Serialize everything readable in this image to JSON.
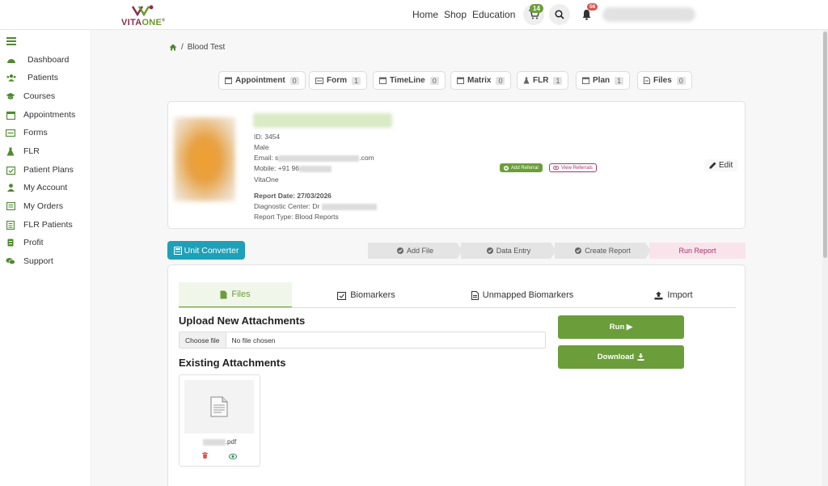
{
  "header": {
    "logo_left": "VITA",
    "logo_right": "ONE",
    "nav": [
      "Home",
      "Shop",
      "Education"
    ],
    "cart_count": "14",
    "notif_count": "56"
  },
  "sidebar": {
    "items": [
      {
        "label": "Dashboard",
        "icon": "dashboard-icon"
      },
      {
        "label": "Patients",
        "icon": "users-icon"
      },
      {
        "label": "Courses",
        "icon": "graduation-cap-icon"
      },
      {
        "label": "Appointments",
        "icon": "calendar-icon"
      },
      {
        "label": "Forms",
        "icon": "form-icon"
      },
      {
        "label": "FLR",
        "icon": "flask-icon"
      },
      {
        "label": "Patient Plans",
        "icon": "calendar-check-icon"
      },
      {
        "label": "My Account",
        "icon": "user-icon"
      },
      {
        "label": "My Orders",
        "icon": "orders-icon"
      },
      {
        "label": "FLR Patients",
        "icon": "list-icon"
      },
      {
        "label": "Profit",
        "icon": "money-icon"
      },
      {
        "label": "Support",
        "icon": "comments-icon"
      }
    ]
  },
  "breadcrumb": {
    "sep": "/",
    "current": "Blood Test"
  },
  "tabs": [
    {
      "label": "Appointment",
      "count": "0"
    },
    {
      "label": "Form",
      "count": "1"
    },
    {
      "label": "TimeLine",
      "count": "0"
    },
    {
      "label": "Matrix",
      "count": "0"
    },
    {
      "label": "FLR",
      "count": "1"
    },
    {
      "label": "Plan",
      "count": "1"
    },
    {
      "label": "Files",
      "count": "0"
    }
  ],
  "patient": {
    "id": "ID: 3454",
    "gender": "Male",
    "email_prefix": "Email: s",
    "email_suffix": ".com",
    "mobile_prefix": "Mobile: +91 96",
    "company": "VitaOne",
    "report_date": "Report Date: 27/03/2026",
    "diag_prefix": "Diagnostic Center: Dr",
    "report_type": "Report Type: Blood Reports",
    "add_referral": "Add Referral",
    "view_referrals": "View Referrals",
    "edit": "Edit"
  },
  "unit_converter": "Unit Converter",
  "steps": [
    "Add File",
    "Data Entry",
    "Create Report",
    "Run Report"
  ],
  "subtabs": [
    "Files",
    "Biomarkers",
    "Unmapped Biomarkers",
    "Import"
  ],
  "upload": {
    "heading": "Upload New Attachments",
    "choose": "Choose file",
    "none": "No file chosen"
  },
  "existing": {
    "heading": "Existing Attachments",
    "file_ext": ".pdf"
  },
  "buttons": {
    "run": "Run ▶",
    "download": "Download"
  },
  "colors": {
    "accent_green": "#6b9e3a",
    "teal": "#1ea0b9",
    "pink": "#f9e4ec",
    "brand_purple": "#5b3b8c"
  }
}
